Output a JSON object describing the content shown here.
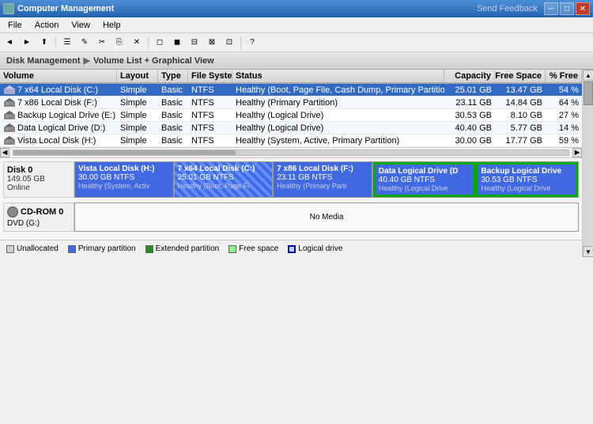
{
  "titlebar": {
    "title": "Computer Management",
    "send_feedback": "Send Feedback",
    "minimize": "─",
    "restore": "□",
    "close": "✕"
  },
  "menu": {
    "items": [
      "File",
      "Action",
      "View",
      "Help"
    ]
  },
  "toolbar": {
    "buttons": [
      "◄",
      "►",
      "⬆",
      "|",
      "☰",
      "✎",
      "✂",
      "⎘",
      "✕",
      "|",
      "←",
      "→",
      "↑",
      "↓",
      "|",
      "⊞",
      "⊟",
      "⊠",
      "⊡"
    ]
  },
  "section_header": {
    "part1": "Disk Management",
    "separator": "▶",
    "part2": "Volume List + Graphical View"
  },
  "table": {
    "headers": [
      "Volume",
      "Layout",
      "Type",
      "File System",
      "Status",
      "Capacity",
      "Free Space",
      "% Free"
    ],
    "rows": [
      {
        "volume": "7 x64 Local Disk (C:)",
        "layout": "Simple",
        "type": "Basic",
        "fs": "NTFS",
        "status": "Healthy (Boot, Page File, Cash Dump, Primary Partition)",
        "capacity": "25.01 GB",
        "free": "13.47 GB",
        "pct": "54 %",
        "selected": true
      },
      {
        "volume": "7 x86 Local Disk (F:)",
        "layout": "Simple",
        "type": "Basic",
        "fs": "NTFS",
        "status": "Healthy (Primary Partition)",
        "capacity": "23.11 GB",
        "free": "14.84 GB",
        "pct": "64 %",
        "selected": false
      },
      {
        "volume": "Backup Logical Drive (E:)",
        "layout": "Simple",
        "type": "Basic",
        "fs": "NTFS",
        "status": "Healthy (Logical Drive)",
        "capacity": "30.53 GB",
        "free": "8.10 GB",
        "pct": "27 %",
        "selected": false
      },
      {
        "volume": "Data Logical Drive (D:)",
        "layout": "Simple",
        "type": "Basic",
        "fs": "NTFS",
        "status": "Healthy (Logical Drive)",
        "capacity": "40.40 GB",
        "free": "5.77 GB",
        "pct": "14 %",
        "selected": false
      },
      {
        "volume": "Vista Local Disk (H:)",
        "layout": "Simple",
        "type": "Basic",
        "fs": "NTFS",
        "status": "Healthy (System, Active, Primary Partition)",
        "capacity": "30.00 GB",
        "free": "17.77 GB",
        "pct": "59 %",
        "selected": false
      }
    ]
  },
  "disk0": {
    "label": "Disk 0",
    "size": "149.05 GB",
    "status": "Online",
    "partitions": [
      {
        "name": "Vista Local Disk  (H:)",
        "size": "30.00 GB NTFS",
        "status": "Healthy (System, Activ",
        "style": "blue",
        "flex": 2
      },
      {
        "name": "7 x64 Local Disk  (C:)",
        "size": "25.01 GB NTFS",
        "status": "Healthy (Boot, Page Fi",
        "style": "stripe",
        "flex": 2
      },
      {
        "name": "7 x86 Local Disk  (F:)",
        "size": "23.11 GB NTFS",
        "status": "Healthy (Primary Parti",
        "style": "blue",
        "flex": 2
      },
      {
        "name": "Data Logical Drive  (D",
        "size": "40.40 GB NTFS",
        "status": "Healthy (Logical Drive",
        "style": "green_border",
        "flex": 2
      },
      {
        "name": "Backup Logical Drive",
        "size": "30.53 GB NTFS",
        "status": "Healthy (Logical Drive",
        "style": "green_border",
        "flex": 2
      }
    ]
  },
  "cdrom0": {
    "label": "CD-ROM 0",
    "type": "DVD (G:)",
    "status": "No Media"
  },
  "legend": {
    "items": [
      {
        "label": "Unallocated",
        "style": "unalloc"
      },
      {
        "label": "Primary partition",
        "style": "primary"
      },
      {
        "label": "Extended partition",
        "style": "extended"
      },
      {
        "label": "Free space",
        "style": "free"
      },
      {
        "label": "Logical drive",
        "style": "logical"
      }
    ]
  }
}
